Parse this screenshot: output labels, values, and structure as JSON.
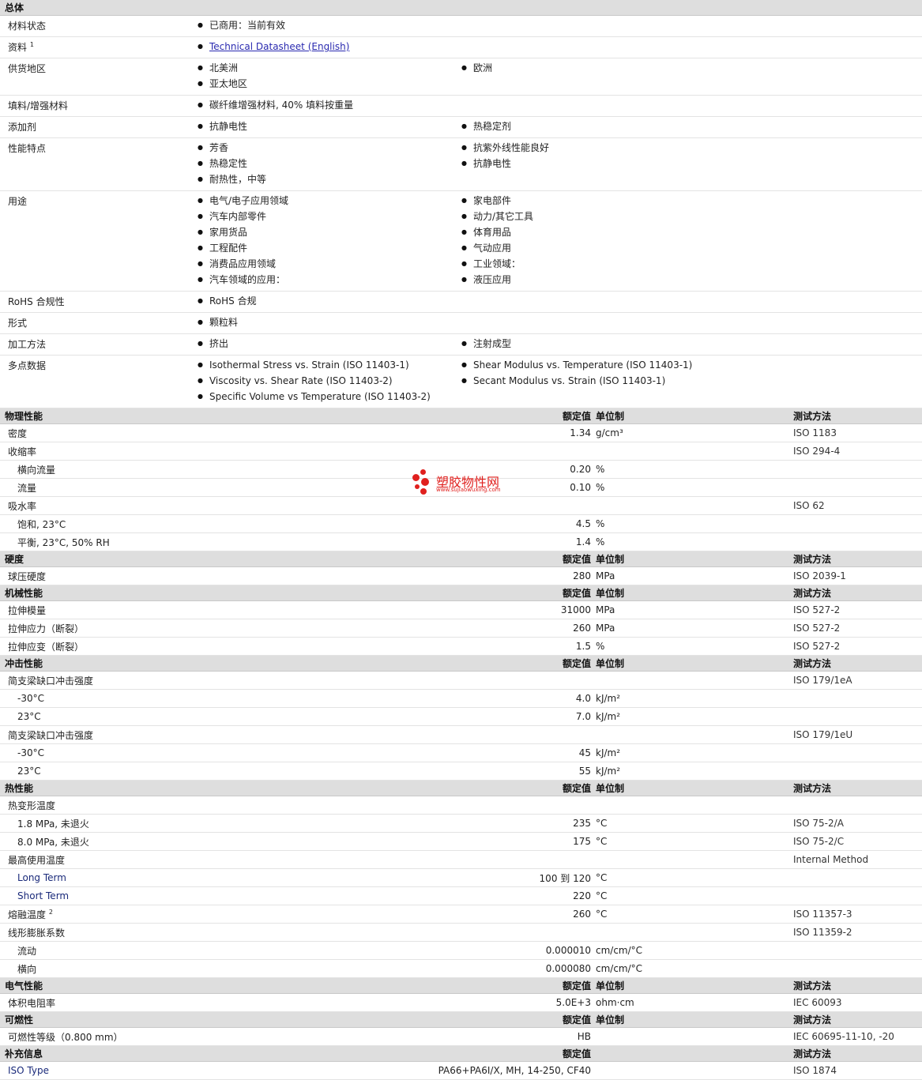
{
  "general": {
    "title": "总体",
    "rows": [
      {
        "label": "材料状态",
        "items": [
          "已商用：当前有效"
        ]
      },
      {
        "label": "资料",
        "sup": "1",
        "link": "Technical Datasheet (English)"
      },
      {
        "label": "供货地区",
        "items": [
          "北美洲",
          "欧洲",
          "亚太地区"
        ]
      },
      {
        "label": "填料/增强材料",
        "items": [
          "碳纤维增强材料, 40% 填料按重量"
        ]
      },
      {
        "label": "添加剂",
        "items": [
          "抗静电性",
          "热稳定剂"
        ]
      },
      {
        "label": "性能特点",
        "items": [
          "芳香",
          "抗紫外线性能良好",
          "热稳定性",
          "抗静电性",
          "耐热性，中等"
        ]
      },
      {
        "label": "用途",
        "items": [
          "电气/电子应用领域",
          "家电部件",
          "汽车内部零件",
          "动力/其它工具",
          "家用货品",
          "体育用品",
          "工程配件",
          "气动应用",
          "消费品应用领域",
          "工业领域：",
          "汽车领域的应用：",
          "液压应用"
        ]
      },
      {
        "label": "RoHS 合规性",
        "items": [
          "RoHS 合规"
        ]
      },
      {
        "label": "形式",
        "items": [
          "颗粒料"
        ]
      },
      {
        "label": "加工方法",
        "items": [
          "挤出",
          "注射成型"
        ]
      },
      {
        "label": "多点数据",
        "items": [
          "Isothermal Stress vs. Strain (ISO 11403-1)",
          "Shear Modulus vs. Temperature (ISO 11403-1)",
          "Viscosity vs. Shear Rate (ISO 11403-2)",
          "Secant Modulus vs. Strain (ISO 11403-1)",
          "Specific Volume vs Temperature (ISO 11403-2)"
        ]
      }
    ]
  },
  "headers": {
    "rated": "额定值",
    "unit": "单位制",
    "method": "测试方法"
  },
  "sections": [
    {
      "title": "物理性能",
      "rows": [
        {
          "label": "密度",
          "value": "1.34",
          "unit": "g/cm³",
          "method": "ISO 1183"
        },
        {
          "label": "收缩率",
          "value": "",
          "unit": "",
          "method": "ISO 294-4"
        },
        {
          "label": "横向流量",
          "sub": true,
          "value": "0.20",
          "unit": "%",
          "method": ""
        },
        {
          "label": "流量",
          "sub": true,
          "value": "0.10",
          "unit": "%",
          "method": ""
        },
        {
          "label": "吸水率",
          "value": "",
          "unit": "",
          "method": "ISO 62"
        },
        {
          "label": "饱和, 23°C",
          "sub": true,
          "value": "4.5",
          "unit": "%",
          "method": ""
        },
        {
          "label": "平衡, 23°C, 50% RH",
          "sub": true,
          "value": "1.4",
          "unit": "%",
          "method": ""
        }
      ]
    },
    {
      "title": "硬度",
      "rows": [
        {
          "label": "球压硬度",
          "value": "280",
          "unit": "MPa",
          "method": "ISO 2039-1"
        }
      ]
    },
    {
      "title": "机械性能",
      "rows": [
        {
          "label": "拉伸模量",
          "value": "31000",
          "unit": "MPa",
          "method": "ISO 527-2"
        },
        {
          "label": "拉伸应力（断裂）",
          "value": "260",
          "unit": "MPa",
          "method": "ISO 527-2"
        },
        {
          "label": "拉伸应变（断裂）",
          "value": "1.5",
          "unit": "%",
          "method": "ISO 527-2"
        }
      ]
    },
    {
      "title": "冲击性能",
      "rows": [
        {
          "label": "简支梁缺口冲击强度",
          "value": "",
          "unit": "",
          "method": "ISO 179/1eA"
        },
        {
          "label": "-30°C",
          "sub": true,
          "value": "4.0",
          "unit": "kJ/m²",
          "method": ""
        },
        {
          "label": "23°C",
          "sub": true,
          "value": "7.0",
          "unit": "kJ/m²",
          "method": ""
        },
        {
          "label": "简支梁缺口冲击强度",
          "value": "",
          "unit": "",
          "method": "ISO 179/1eU"
        },
        {
          "label": "-30°C",
          "sub": true,
          "value": "45",
          "unit": "kJ/m²",
          "method": ""
        },
        {
          "label": "23°C",
          "sub": true,
          "value": "55",
          "unit": "kJ/m²",
          "method": ""
        }
      ]
    },
    {
      "title": "热性能",
      "rows": [
        {
          "label": "热变形温度",
          "value": "",
          "unit": "",
          "method": ""
        },
        {
          "label": "1.8 MPa, 未退火",
          "sub": true,
          "value": "235",
          "unit": "°C",
          "method": "ISO 75-2/A"
        },
        {
          "label": "8.0 MPa, 未退火",
          "sub": true,
          "value": "175",
          "unit": "°C",
          "method": "ISO 75-2/C"
        },
        {
          "label": "最高使用温度",
          "value": "",
          "unit": "",
          "method": "Internal Method"
        },
        {
          "label": "Long Term",
          "sub": true,
          "en": true,
          "value": "100 到 120",
          "unit": "°C",
          "method": ""
        },
        {
          "label": "Short Term",
          "sub": true,
          "en": true,
          "value": "220",
          "unit": "°C",
          "method": ""
        },
        {
          "label": "熔融温度",
          "sup": "2",
          "value": "260",
          "unit": "°C",
          "method": "ISO 11357-3"
        },
        {
          "label": "线形膨胀系数",
          "value": "",
          "unit": "",
          "method": "ISO 11359-2"
        },
        {
          "label": "流动",
          "sub": true,
          "value": "0.000010",
          "unit": "cm/cm/°C",
          "method": ""
        },
        {
          "label": "横向",
          "sub": true,
          "value": "0.000080",
          "unit": "cm/cm/°C",
          "method": ""
        }
      ]
    },
    {
      "title": "电气性能",
      "rows": [
        {
          "label": "体积电阻率",
          "value": "5.0E+3",
          "unit": "ohm·cm",
          "method": "IEC 60093"
        }
      ]
    },
    {
      "title": "可燃性",
      "rows": [
        {
          "label": "可燃性等级（0.800 mm）",
          "value": "HB",
          "unit": "",
          "method": "IEC 60695-11-10, -20"
        }
      ]
    },
    {
      "title": "补充信息",
      "no_unit_header": true,
      "rows": [
        {
          "label": "ISO Type",
          "en": true,
          "value": "PA66+PA6I/X, MH, 14-250, CF40",
          "unit": "",
          "method": "ISO 1874"
        }
      ]
    }
  ],
  "watermark": {
    "text": "塑胶物性网",
    "url": "www.sujiaowuxing.com"
  }
}
